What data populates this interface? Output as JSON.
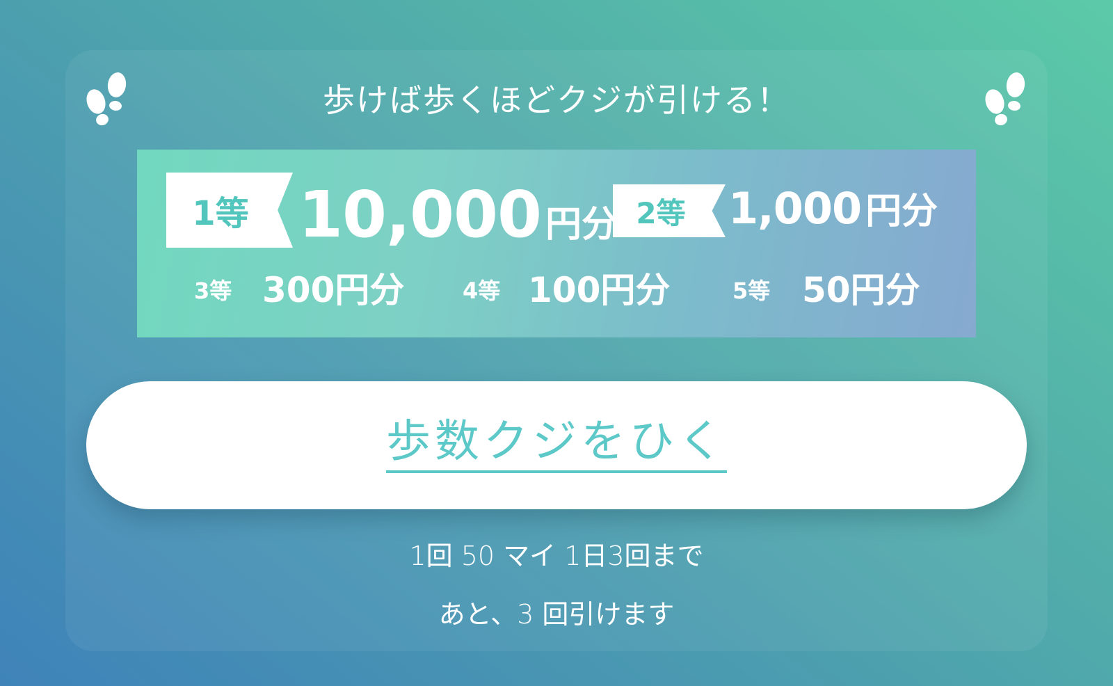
{
  "headline": "歩けば歩くほどクジが引ける！",
  "icons": {
    "left": "footprints-icon",
    "right": "footprints-icon"
  },
  "prizes": {
    "first": {
      "rank": "1等",
      "amount": "10,000",
      "unit": "円分"
    },
    "second": {
      "rank": "2等",
      "amount": "1,000",
      "unit": "円分"
    },
    "third": {
      "rank": "3等",
      "amount": "300円分"
    },
    "fourth": {
      "rank": "4等",
      "amount": "100円分"
    },
    "fifth": {
      "rank": "5等",
      "amount": "50円分"
    }
  },
  "button": {
    "label": "歩数クジをひく"
  },
  "info": {
    "cost": "1回 50 マイ 1日3回まで",
    "remaining": "あと、3 回引けます"
  },
  "colors": {
    "accent": "#5cc8c8",
    "background_start": "#3f83b9",
    "background_end": "#5ccaa8"
  }
}
